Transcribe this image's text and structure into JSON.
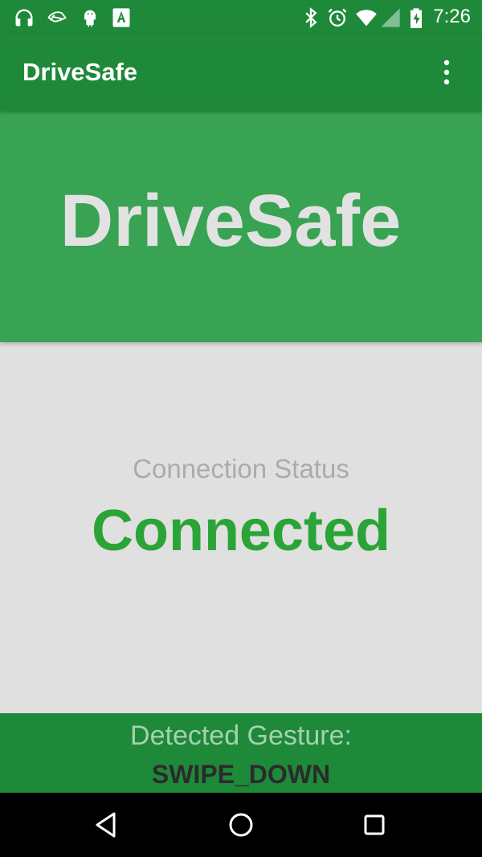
{
  "status_bar": {
    "time": "7:26",
    "left_icons": [
      "headphones-icon",
      "leaf-icon",
      "android-icon",
      "keyboard-a-icon"
    ],
    "right_icons": [
      "bluetooth-icon",
      "alarm-icon",
      "wifi-icon",
      "signal-icon",
      "battery-charging-icon"
    ]
  },
  "app_bar": {
    "title": "DriveSafe",
    "menu_icon": "more-vert-icon"
  },
  "banner": {
    "title": "DriveSafe"
  },
  "connection": {
    "label": "Connection Status",
    "value": "Connected"
  },
  "gesture": {
    "label": "Detected Gesture:",
    "value": "SWIPE_DOWN"
  },
  "nav_bar": {
    "buttons": [
      "back-icon",
      "home-icon",
      "recents-icon"
    ]
  },
  "colors": {
    "primary_dark": "#1e8939",
    "primary": "#38a352",
    "accent_connected": "#2ba437",
    "background": "#e0e0e0"
  }
}
